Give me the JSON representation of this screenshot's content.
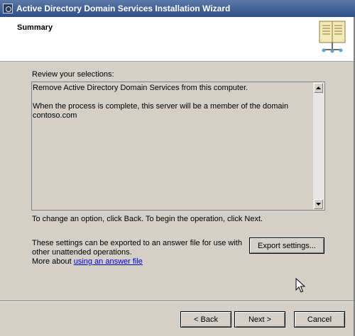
{
  "window": {
    "title": "Active Directory Domain Services Installation Wizard"
  },
  "header": {
    "page_title": "Summary"
  },
  "summary": {
    "label": "Review your selections:",
    "text": "Remove Active Directory Domain Services from this computer.\n\nWhen the process is complete, this server will be a member of the domain contoso.com"
  },
  "instruction": "To change an option, click Back. To begin the operation, click Next.",
  "export": {
    "text": "These settings can be exported to an answer file for use with other unattended operations.",
    "more_prefix": "More about ",
    "link_label": "using an answer file",
    "button_label": "Export settings..."
  },
  "buttons": {
    "back": "< Back",
    "next": "Next >",
    "cancel": "Cancel"
  },
  "icons": {
    "app": "ad-wizard-icon",
    "header": "book-icon",
    "scroll_up": "scroll-up-icon",
    "scroll_down": "scroll-down-icon",
    "cursor": "mouse-pointer-icon"
  }
}
